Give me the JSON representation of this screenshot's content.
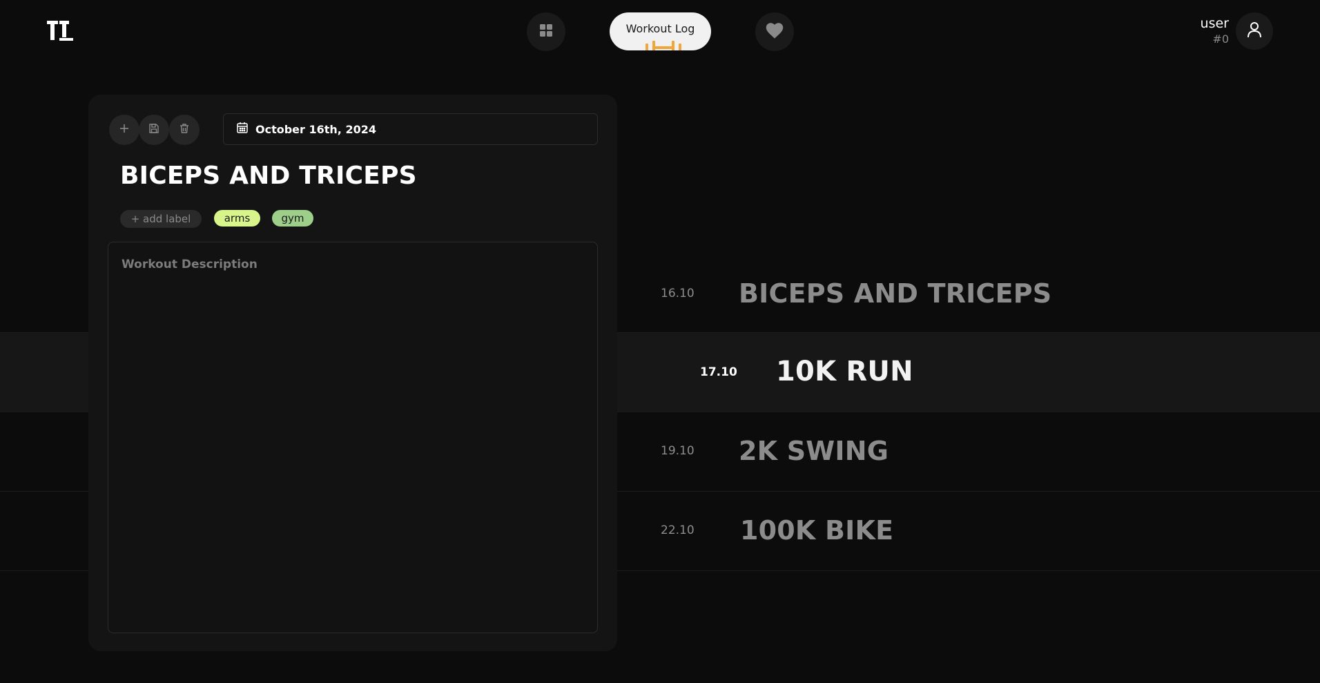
{
  "header": {
    "active_nav_label": "Workout Log",
    "user": {
      "name": "user",
      "id": "#0"
    }
  },
  "editor": {
    "date": "October 16th, 2024",
    "title": "BICEPS AND TRICEPS",
    "add_label": "+ add label",
    "labels": [
      {
        "text": "arms",
        "color": "#d8f58c"
      },
      {
        "text": "gym",
        "color": "#9dcf8a"
      }
    ],
    "description_placeholder": "Workout Description"
  },
  "timeline": [
    {
      "date": "16.10",
      "title": "BICEPS AND TRICEPS",
      "active": false
    },
    {
      "date": "17.10",
      "title": "10K RUN",
      "active": true
    },
    {
      "date": "19.10",
      "title": "2K SWING",
      "active": false
    },
    {
      "date": "22.10",
      "title": "100K BIKE",
      "active": false
    }
  ],
  "colors": {
    "background": "#0c0c0c",
    "panel": "#141414",
    "accent": "#f0a63a"
  }
}
